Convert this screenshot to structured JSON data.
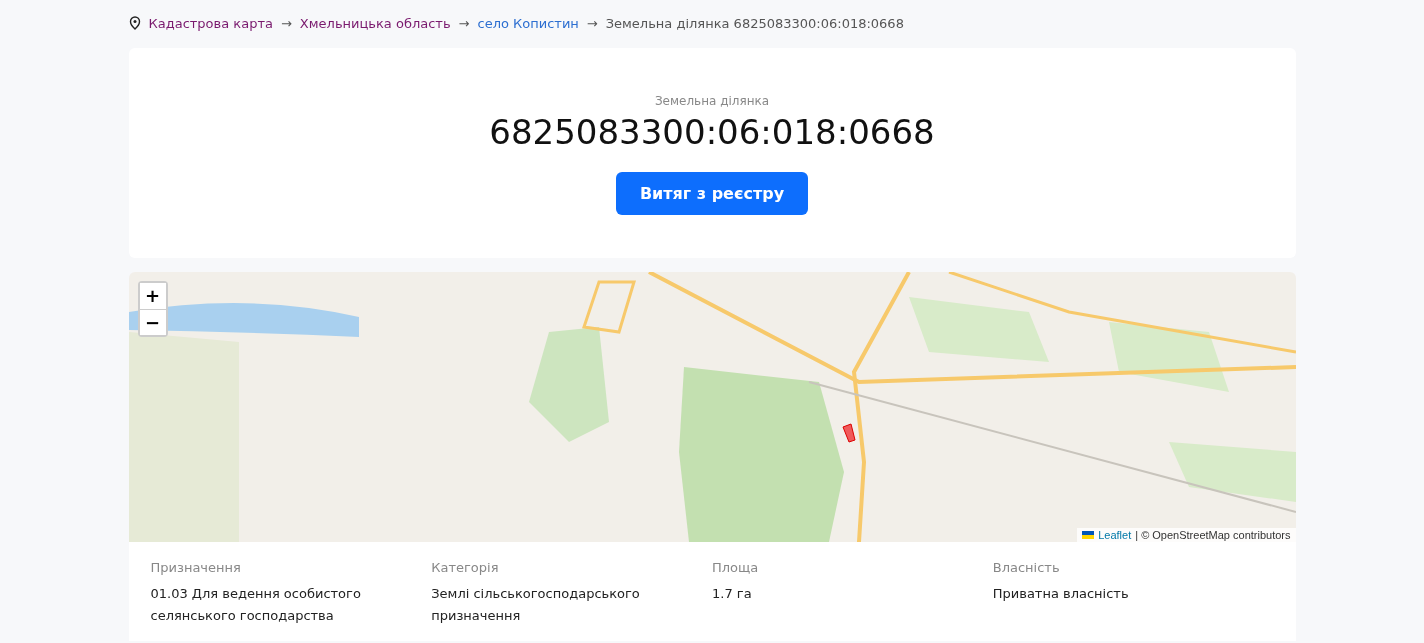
{
  "breadcrumbs": [
    {
      "kind": "link",
      "text": "Кадастрова карта",
      "visited": true
    },
    {
      "kind": "arrow",
      "text": "→"
    },
    {
      "kind": "link",
      "text": "Хмельницька область",
      "visited": true
    },
    {
      "kind": "arrow",
      "text": "→"
    },
    {
      "kind": "link",
      "text": "село Копистин",
      "visited": false
    },
    {
      "kind": "arrow",
      "text": "→"
    },
    {
      "kind": "current",
      "text": "Земельна ділянка 6825083300:06:018:0668"
    }
  ],
  "header": {
    "subtitle": "Земельна ділянка",
    "number": "6825083300:06:018:0668",
    "button": "Витяг з реєстру"
  },
  "map": {
    "zoom_in": "+",
    "zoom_out": "−",
    "attribution_link": "Leaflet",
    "attribution_text": "| © OpenStreetMap contributors"
  },
  "details": [
    {
      "label": "Призначення",
      "value": "01.03 Для ведення особистого селянського господарства"
    },
    {
      "label": "Категорія",
      "value": "Землі сільськогосподарського призначення"
    },
    {
      "label": "Площа",
      "value": "1.7 га"
    },
    {
      "label": "Власність",
      "value": "Приватна власність"
    }
  ]
}
